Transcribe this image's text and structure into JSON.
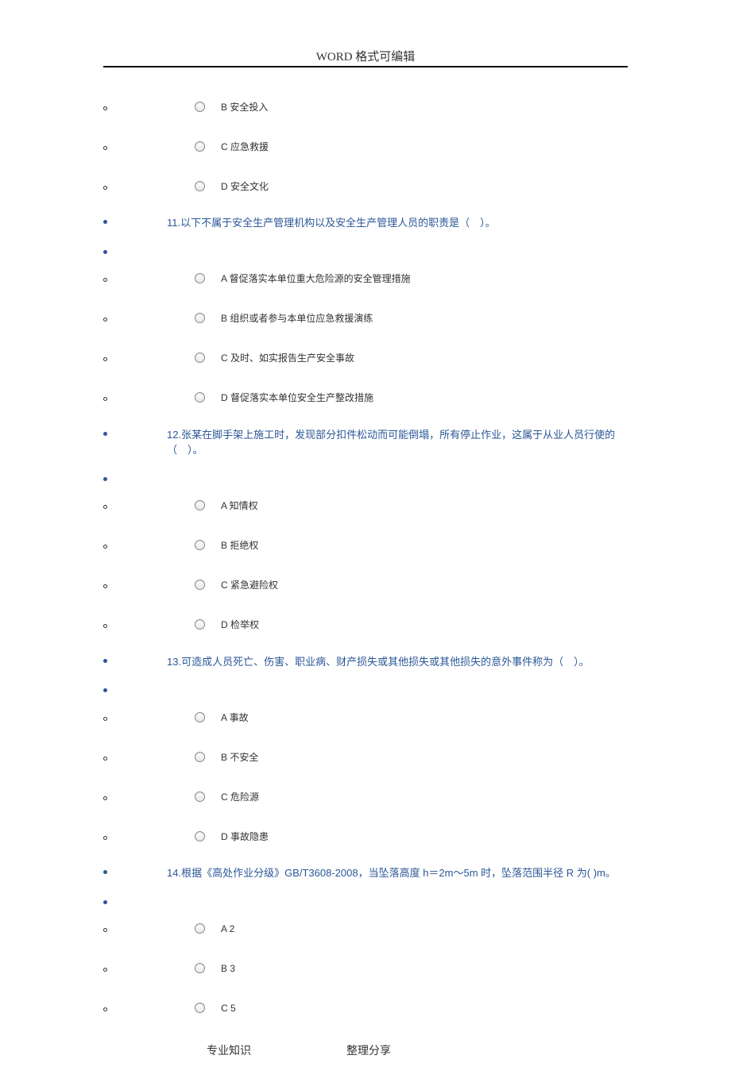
{
  "header": "WORD 格式可编辑",
  "footer": {
    "left": "专业知识",
    "right": "整理分享"
  },
  "groups": [
    {
      "type": "options",
      "items": [
        {
          "letter": "B",
          "text": "安全投入"
        },
        {
          "letter": "C",
          "text": "应急救援"
        },
        {
          "letter": "D",
          "text": "安全文化"
        }
      ]
    },
    {
      "type": "question",
      "text": "11.以下不属于安全生产管理机构以及安全生产管理人员的职责是（　）。"
    },
    {
      "type": "options",
      "items": [
        {
          "letter": "A",
          "text": "督促落实本单位重大危险源的安全管理措施"
        },
        {
          "letter": "B",
          "text": "组织或者参与本单位应急救援演练"
        },
        {
          "letter": "C",
          "text": "及时、如实报告生产安全事故"
        },
        {
          "letter": "D",
          "text": "督促落实本单位安全生产整改措施"
        }
      ]
    },
    {
      "type": "question",
      "text": "12.张某在脚手架上施工时，发现部分扣件松动而可能倒塌，所有停止作业，这属于从业人员行使的（　）。"
    },
    {
      "type": "options",
      "items": [
        {
          "letter": "A",
          "text": "知情权"
        },
        {
          "letter": "B",
          "text": "拒绝权"
        },
        {
          "letter": "C",
          "text": "紧急避险权"
        },
        {
          "letter": "D",
          "text": "检举权"
        }
      ]
    },
    {
      "type": "question",
      "text": "13.可造成人员死亡、伤害、职业病、财产损失或其他损失或其他损失的意外事件称为（　）。"
    },
    {
      "type": "options",
      "items": [
        {
          "letter": "A",
          "text": "事故"
        },
        {
          "letter": "B",
          "text": "不安全"
        },
        {
          "letter": "C",
          "text": "危险源"
        },
        {
          "letter": "D",
          "text": "事故隐患"
        }
      ]
    },
    {
      "type": "question",
      "text": "14.根据《高处作业分级》GB/T3608-2008，当坠落高度 h＝2m～5m 时，坠落范围半径 R 为( )m。"
    },
    {
      "type": "options",
      "items": [
        {
          "letter": "A",
          "text": "2"
        },
        {
          "letter": "B",
          "text": "3"
        },
        {
          "letter": "C",
          "text": "5"
        }
      ]
    }
  ]
}
